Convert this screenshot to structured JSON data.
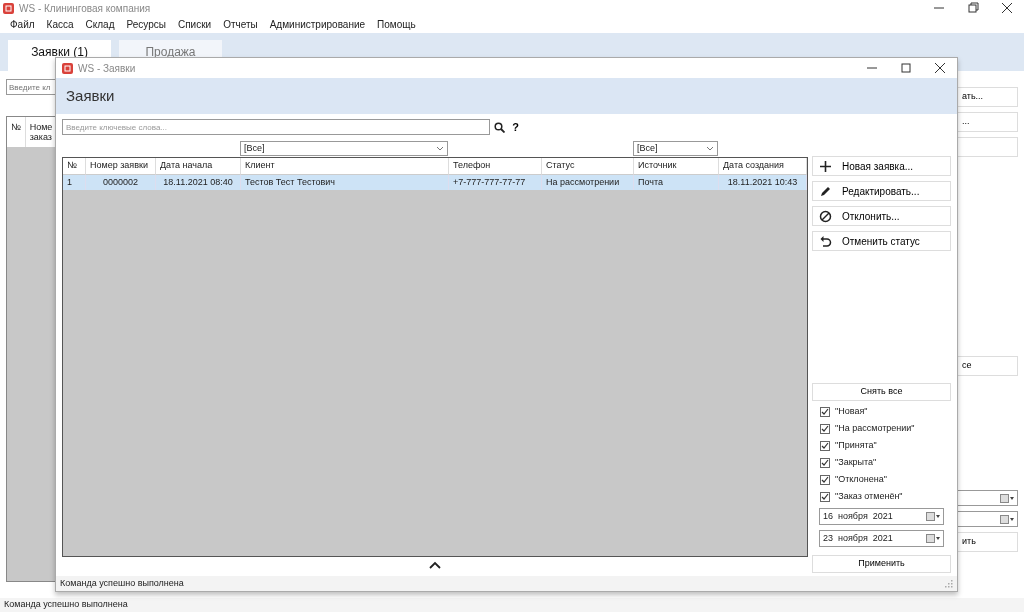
{
  "main_window": {
    "title": "WS - Клининговая компания"
  },
  "menu": [
    "Файл",
    "Касса",
    "Склад",
    "Ресурсы",
    "Списки",
    "Отчеты",
    "Администрирование",
    "Помощь"
  ],
  "tabs": [
    {
      "label": "Заявки (1)",
      "selected": true
    },
    {
      "label": "Продажа",
      "selected": false
    }
  ],
  "background": {
    "search": {
      "placeholder": "Введите кл"
    },
    "column_headers": [
      {
        "lines": [
          "№"
        ]
      },
      {
        "lines": [
          "Номе",
          "заказ"
        ]
      }
    ],
    "top_buttons": [
      "ать...",
      "..."
    ],
    "middle_button": "се",
    "apply_button": "ить"
  },
  "status_bar": "Команда успешно выполнена",
  "dialog": {
    "title": "WS - Заявки",
    "heading": "Заявки",
    "search": {
      "placeholder": "Введите ключевые слова...",
      "help": "?"
    },
    "columns": [
      {
        "label": "№"
      },
      {
        "label": "Номер заявки"
      },
      {
        "label": "Дата начала"
      },
      {
        "label": "Клиент",
        "filter": "[Все]"
      },
      {
        "label": "Телефон"
      },
      {
        "label": "Статус"
      },
      {
        "label": "Источник",
        "filter": "[Все]"
      },
      {
        "label": "Дата создания"
      }
    ],
    "rows": [
      {
        "selected": true,
        "cells": [
          "1",
          "0000002",
          "18.11.2021 08:40",
          "Тестов Тест Тестович",
          "+7-777-777-77-77",
          "На рассмотрении",
          "Почта",
          "18.11.2021 10:43"
        ]
      }
    ],
    "actions": [
      {
        "kind": "add",
        "label": "Новая заявка..."
      },
      {
        "kind": "edit",
        "label": "Редактировать..."
      },
      {
        "kind": "reject",
        "label": "Отклонить..."
      },
      {
        "kind": "undo",
        "label": "Отменить статус"
      }
    ],
    "clear_all": "Снять все",
    "statuses": [
      {
        "label": "\"Новая\"",
        "checked": true
      },
      {
        "label": "\"На рассмотрении\"",
        "checked": true
      },
      {
        "label": "\"Принята\"",
        "checked": true
      },
      {
        "label": "\"Закрыта\"",
        "checked": true
      },
      {
        "label": "\"Отклонена\"",
        "checked": true
      },
      {
        "label": "\"Заказ отменён\"",
        "checked": true
      }
    ],
    "dates": [
      "16  ноября  2021",
      "23  ноября  2021"
    ],
    "apply": "Применить",
    "status_bar": "Команда успешно выполнена"
  }
}
